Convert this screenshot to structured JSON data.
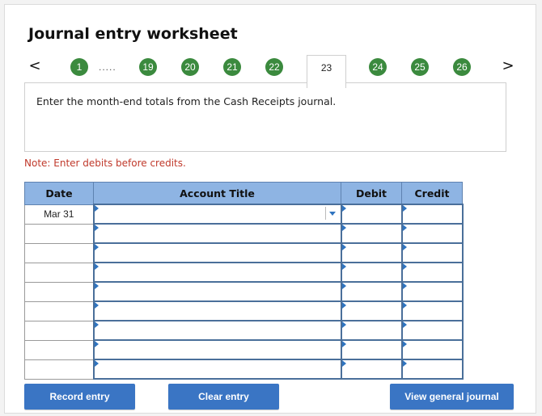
{
  "title": "Journal entry worksheet",
  "navigation": {
    "prev_label": "<",
    "next_label": ">",
    "first_step": "1",
    "ellipsis": ".....",
    "steps_before": [
      "19",
      "20",
      "21",
      "22"
    ],
    "current_step": "23",
    "steps_after": [
      "24",
      "25",
      "26"
    ]
  },
  "instruction": "Enter the month-end totals from the Cash Receipts journal.",
  "note": "Note: Enter debits before credits.",
  "table": {
    "headers": {
      "date": "Date",
      "account": "Account Title",
      "debit": "Debit",
      "credit": "Credit"
    },
    "rows": [
      {
        "date": "Mar 31",
        "account": "",
        "debit": "",
        "credit": ""
      },
      {
        "date": "",
        "account": "",
        "debit": "",
        "credit": ""
      },
      {
        "date": "",
        "account": "",
        "debit": "",
        "credit": ""
      },
      {
        "date": "",
        "account": "",
        "debit": "",
        "credit": ""
      },
      {
        "date": "",
        "account": "",
        "debit": "",
        "credit": ""
      },
      {
        "date": "",
        "account": "",
        "debit": "",
        "credit": ""
      },
      {
        "date": "",
        "account": "",
        "debit": "",
        "credit": ""
      },
      {
        "date": "",
        "account": "",
        "debit": "",
        "credit": ""
      },
      {
        "date": "",
        "account": "",
        "debit": "",
        "credit": ""
      }
    ]
  },
  "buttons": {
    "record": "Record entry",
    "clear": "Clear entry",
    "view": "View general journal"
  },
  "colors": {
    "step_green": "#3b8a3e",
    "header_blue": "#8eb4e3",
    "button_blue": "#3a75c4",
    "note_red": "#c0392b"
  }
}
